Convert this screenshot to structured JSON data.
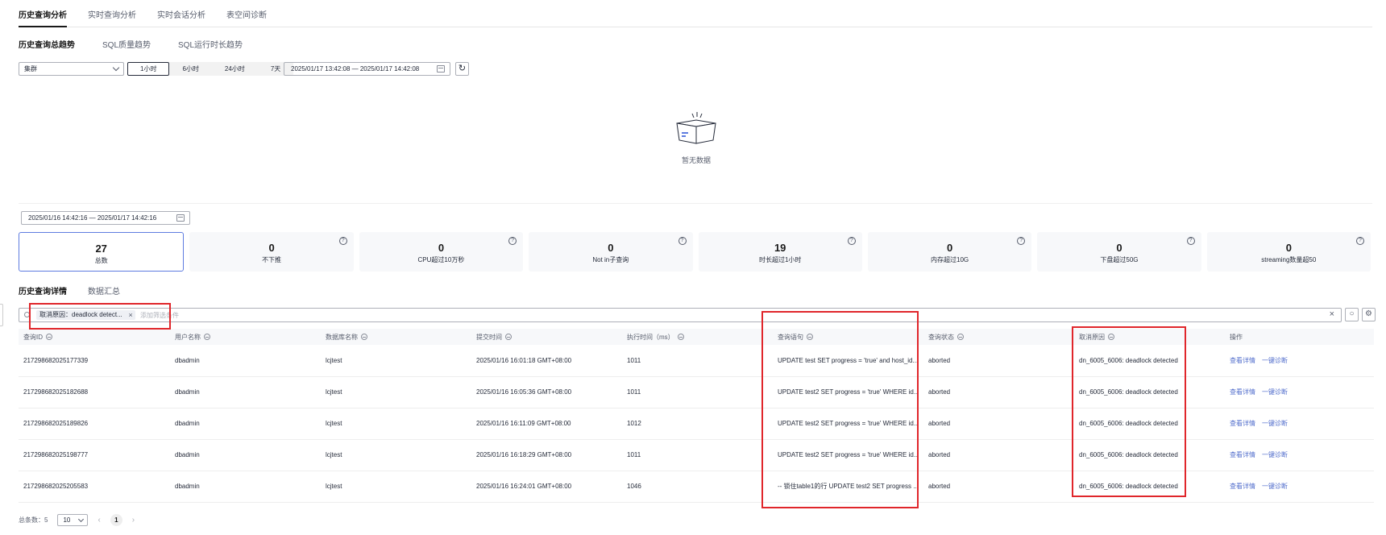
{
  "top_tabs": [
    "历史查询分析",
    "实时查询分析",
    "实时会话分析",
    "表空间诊断"
  ],
  "sub_tabs": [
    "历史查询总趋势",
    "SQL质量趋势",
    "SQL运行时长趋势"
  ],
  "filters": {
    "cluster": "集群",
    "ranges": [
      "1小时",
      "6小时",
      "24小时",
      "7天"
    ],
    "date_range": "2025/01/17 13:42:08 — 2025/01/17 14:42:08"
  },
  "empty_state": {
    "text": "暂无数据"
  },
  "stats_date_range": "2025/01/16 14:42:16 — 2025/01/17 14:42:16",
  "stat_cards": [
    {
      "value": "27",
      "label": "总数"
    },
    {
      "value": "0",
      "label": "不下推"
    },
    {
      "value": "0",
      "label": "CPU超过10万秒"
    },
    {
      "value": "0",
      "label": "Not in子查询"
    },
    {
      "value": "19",
      "label": "时长超过1小时"
    },
    {
      "value": "0",
      "label": "内存超过10G"
    },
    {
      "value": "0",
      "label": "下盘超过50G"
    },
    {
      "value": "0",
      "label": "streaming数量超50"
    }
  ],
  "detail_tabs": [
    "历史查询详情",
    "数据汇总"
  ],
  "search": {
    "tag": "取消原因：deadlock detect...",
    "placeholder": "添加筛选条件"
  },
  "table": {
    "columns": [
      "查询ID",
      "用户名称",
      "数据库名称",
      "提交时间",
      "执行时间（ms）",
      "查询语句",
      "查询状态",
      "取消原因",
      "操作"
    ],
    "rows": [
      [
        "217298682025177339",
        "dbadmin",
        "lcjtest",
        "2025/01/16 16:01:18 GMT+08:00",
        "1011",
        "UPDATE test SET progress = 'true' and host_id...",
        "aborted",
        "dn_6005_6006: deadlock detected"
      ],
      [
        "217298682025182688",
        "dbadmin",
        "lcjtest",
        "2025/01/16 16:05:36 GMT+08:00",
        "1011",
        "UPDATE test2 SET progress = 'true' WHERE id...",
        "aborted",
        "dn_6005_6006: deadlock detected"
      ],
      [
        "217298682025189826",
        "dbadmin",
        "lcjtest",
        "2025/01/16 16:11:09 GMT+08:00",
        "1012",
        "UPDATE test2 SET progress = 'true' WHERE id...",
        "aborted",
        "dn_6005_6006: deadlock detected"
      ],
      [
        "217298682025198777",
        "dbadmin",
        "lcjtest",
        "2025/01/16 16:18:29 GMT+08:00",
        "1011",
        "UPDATE test2 SET progress = 'true' WHERE id...",
        "aborted",
        "dn_6005_6006: deadlock detected"
      ],
      [
        "217298682025205583",
        "dbadmin",
        "lcjtest",
        "2025/01/16 16:24:01 GMT+08:00",
        "1046",
        "-- 锁住table1的行 UPDATE test2 SET progress ...",
        "aborted",
        "dn_6005_6006: deadlock detected"
      ]
    ],
    "actions": [
      "查看详情",
      "一键诊断"
    ]
  },
  "pagination": {
    "total": "总条数：5",
    "page_size": "10",
    "current_page": "1"
  },
  "colors": {
    "accent": "#5e7ce0",
    "link": "#526ecc",
    "highlight": "#e0262b"
  }
}
